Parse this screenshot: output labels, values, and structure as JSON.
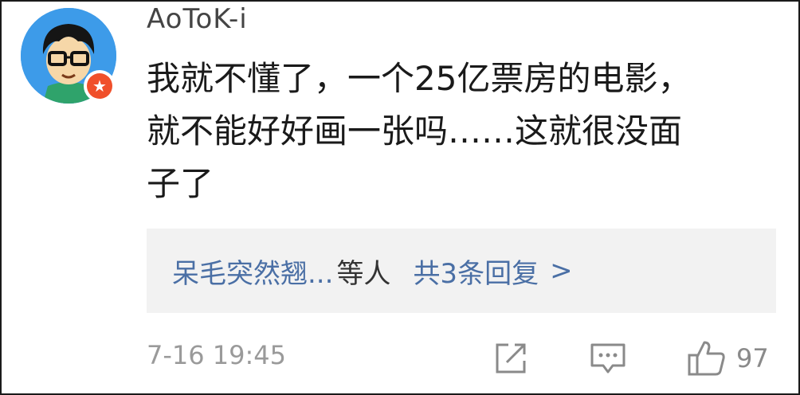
{
  "comment": {
    "username": "AoToK-i",
    "text": "我就不懂了，一个25亿票房的电影，\n就不能好好画一张吗……这就很没面\n子了",
    "badge_glyph": "★",
    "replies": {
      "names": "呆毛突然翘...",
      "suffix": "等人",
      "link": "共3条回复",
      "chevron": ">"
    },
    "timestamp": "7-16 19:45",
    "actions": {
      "share_icon": "share-icon",
      "comment_icon": "comment-icon",
      "like_icon": "thumbs-up-icon",
      "like_count": "97"
    }
  },
  "colors": {
    "avatar_bg": "#3d9be9",
    "badge": "#f0502b",
    "link_blue": "#4a6fa5",
    "reply_bg": "#f2f2f2",
    "muted_gray": "#9a9a9a"
  }
}
